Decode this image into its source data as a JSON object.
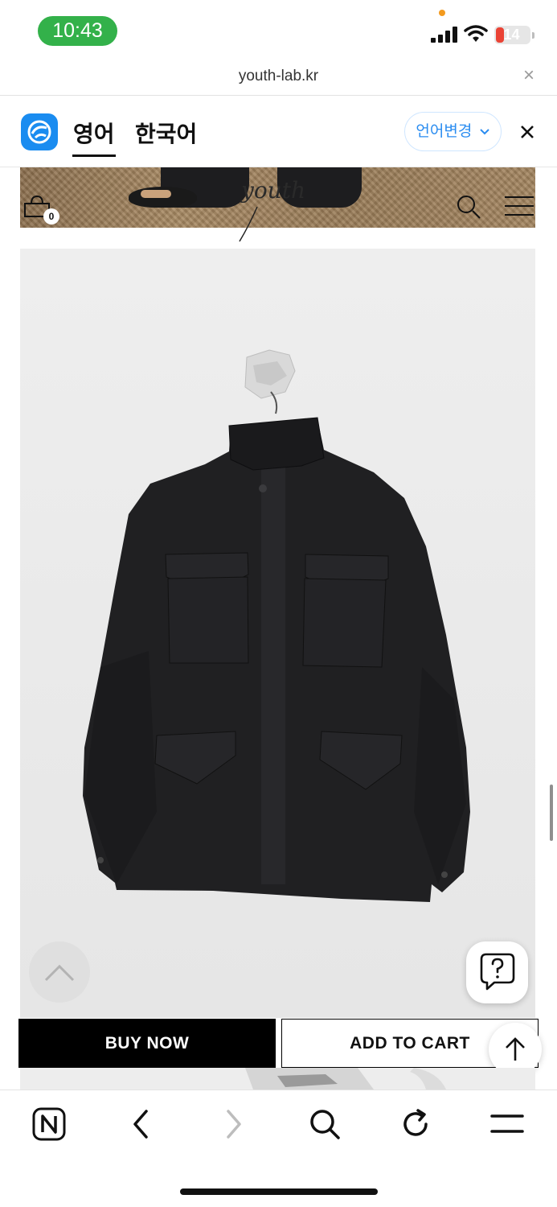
{
  "status_bar": {
    "time": "10:43",
    "battery_level": "14",
    "icons": [
      "signal-icon",
      "wifi-icon",
      "battery-icon"
    ],
    "colors": {
      "time_pill": "#33b14a",
      "battery_low": "#ea4335",
      "privacy_dot": "#f39a1e"
    }
  },
  "url_bar": {
    "url": "youth-lab.kr",
    "close_icon": "close-icon"
  },
  "translate_bar": {
    "logo_icon": "papago-logo-icon",
    "tabs": [
      {
        "label": "영어",
        "active": true
      },
      {
        "label": "한국어",
        "active": false
      }
    ],
    "change_language_label": "언어변경",
    "change_language_icon": "chevron-down-icon",
    "close_icon": "close-icon",
    "accent": "#2a8cf0"
  },
  "site_header": {
    "logo": "youth",
    "cart_icon": "cart-icon",
    "cart_count": "0",
    "search_icon": "search-icon",
    "menu_icon": "hamburger-menu-icon"
  },
  "product": {
    "image_icon": "jacket-photo",
    "help_icon": "question-chat-icon",
    "scroll_top_icon": "chevron-up-icon"
  },
  "cta": {
    "buy_now_label": "BUY NOW",
    "add_to_cart_label": "ADD TO CART",
    "to_top_icon": "arrow-up-icon"
  },
  "bottom_toolbar": {
    "icons": [
      "naver-home-icon",
      "back-icon",
      "forward-icon",
      "search-icon",
      "refresh-icon",
      "menu-icon"
    ]
  }
}
